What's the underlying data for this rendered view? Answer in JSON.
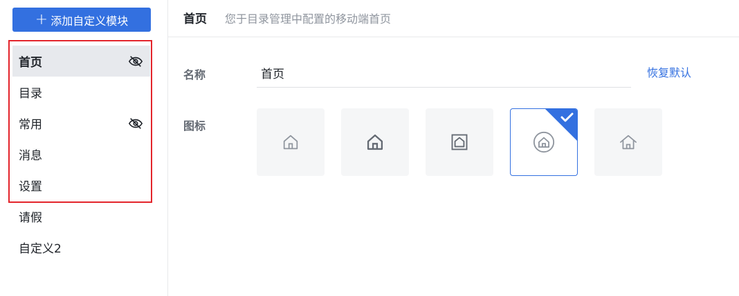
{
  "sidebar": {
    "add_button_label": "添加自定义模块",
    "items": [
      {
        "label": "首页",
        "hidden_icon": true
      },
      {
        "label": "目录",
        "hidden_icon": false
      },
      {
        "label": "常用",
        "hidden_icon": true
      },
      {
        "label": "消息",
        "hidden_icon": false
      },
      {
        "label": "设置",
        "hidden_icon": false
      },
      {
        "label": "请假",
        "hidden_icon": false
      },
      {
        "label": "自定义2",
        "hidden_icon": false
      }
    ],
    "active_index": 0
  },
  "header": {
    "title": "首页",
    "description": "您于目录管理中配置的移动端首页"
  },
  "form": {
    "name_label": "名称",
    "name_value": "首页",
    "reset_label": "恢复默认",
    "icon_label": "图标",
    "icons": [
      "home-outline-icon",
      "home-door-icon",
      "home-square-icon",
      "home-circle-icon",
      "home-roof-icon"
    ],
    "selected_icon_index": 3
  },
  "colors": {
    "accent": "#3370e0",
    "highlight_border": "#e3242b",
    "active_bg": "#e7e9ed"
  }
}
